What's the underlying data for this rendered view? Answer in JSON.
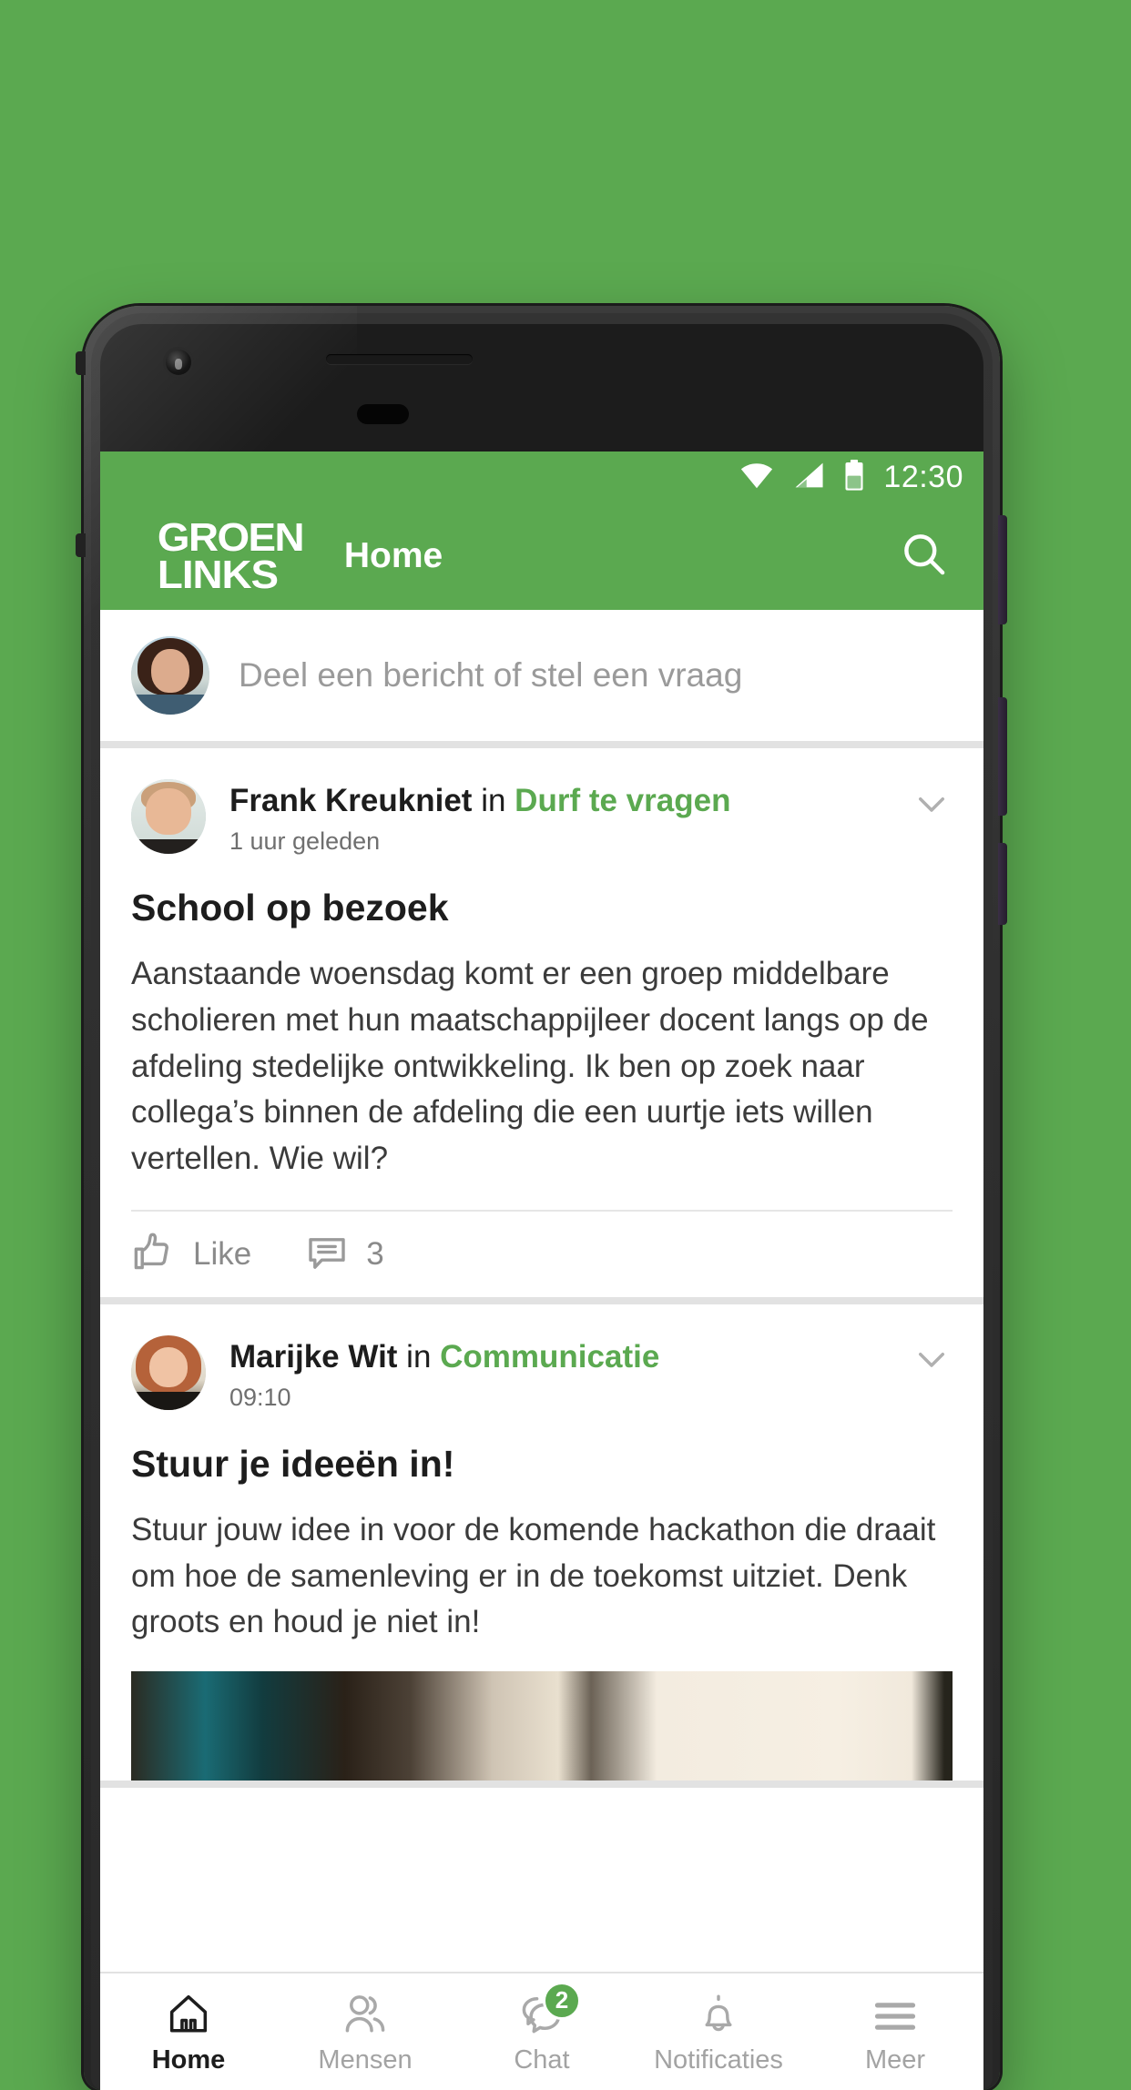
{
  "theme": {
    "brand_green": "#5ba950",
    "page_background": "#5ba950",
    "text_dark": "#1d1d1d",
    "text_muted": "#8a8a8a"
  },
  "statusbar": {
    "time": "12:30",
    "icons": [
      "wifi-icon",
      "cellular-signal-icon",
      "battery-icon"
    ]
  },
  "appbar": {
    "logo_line1": "GROEN",
    "logo_line2": "LINKS",
    "title": "Home",
    "search_icon": "search-icon"
  },
  "composer": {
    "placeholder": "Deel een bericht of stel een vraag",
    "avatar": "user-avatar"
  },
  "posts": [
    {
      "author": "Frank Kreukniet",
      "connector": " in ",
      "group": "Durf te vragen",
      "time": "1 uur geleden",
      "title": "School op bezoek",
      "body": "Aanstaande woensdag komt er een groep middelbare scholieren met hun maatschappijleer docent langs op de afdeling stedelijke ontwikkeling. Ik ben op zoek naar collega’s binnen de afdeling die een uurtje iets willen vertellen. Wie wil?",
      "like_label": "Like",
      "comment_count": "3",
      "has_image": false
    },
    {
      "author": "Marijke Wit",
      "connector": " in ",
      "group": "Communicatie",
      "time": "09:10",
      "title": "Stuur je ideeën in!",
      "body": "Stuur jouw idee in voor de komende hackathon die draait om hoe de samenleving er in de toekomst uitziet. Denk groots en houd je niet in!",
      "has_image": true
    }
  ],
  "tabbar": {
    "items": [
      {
        "label": "Home",
        "icon": "home-icon",
        "active": true,
        "badge": ""
      },
      {
        "label": "Mensen",
        "icon": "people-icon",
        "active": false,
        "badge": ""
      },
      {
        "label": "Chat",
        "icon": "chat-bubbles-icon",
        "active": false,
        "badge": "2"
      },
      {
        "label": "Notificaties",
        "icon": "bell-icon",
        "active": false,
        "badge": ""
      },
      {
        "label": "Meer",
        "icon": "hamburger-icon",
        "active": false,
        "badge": ""
      }
    ]
  }
}
